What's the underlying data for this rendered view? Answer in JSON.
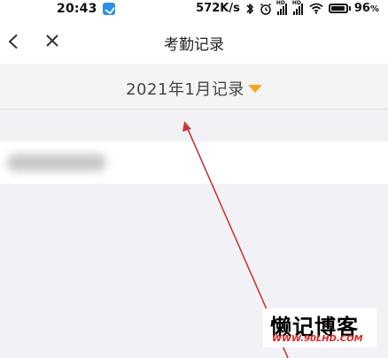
{
  "status_bar": {
    "time": "20:43",
    "net_speed": "572K/s",
    "hd_label": "HD",
    "battery_percent": 96,
    "battery_text": "96",
    "battery_unit": "%"
  },
  "nav": {
    "title": "考勤记录"
  },
  "month_selector": {
    "label": "2021年1月记录",
    "caret_color": "#f5a623"
  },
  "annotation": {
    "arrow_color": "#c83a3a"
  },
  "watermark": {
    "title": "懒记博客",
    "url": "WWW.90LHD.COM"
  }
}
